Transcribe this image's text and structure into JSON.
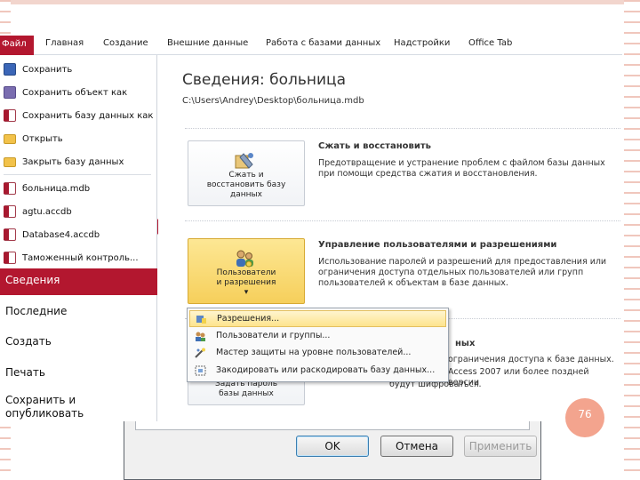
{
  "ribbon": {
    "file_tab": "Файл",
    "tabs": [
      "Главная",
      "Создание",
      "Внешние данные",
      "Работа с базами данных",
      "Надстройки",
      "Office Tab"
    ]
  },
  "left_nav": {
    "commands": [
      "Сохранить",
      "Сохранить объект как",
      "Сохранить базу данных как",
      "Открыть",
      "Закрыть базу данных"
    ],
    "recent_files": [
      "больница.mdb",
      "agtu.accdb",
      "Database4.accdb",
      "Таможенный контроль..."
    ],
    "sections": {
      "active": "Сведения",
      "recent": "Последние",
      "create": "Создать",
      "print": "Печать",
      "save_publish": "Сохранить и опубликовать"
    }
  },
  "main": {
    "title": "Сведения: больница",
    "path": "C:\\Users\\Andrey\\Desktop\\больница.mdb",
    "compact": {
      "button": "Сжать и восстановить базу данных",
      "heading": "Сжать и восстановить",
      "text": "Предотвращение и устранение проблем с файлом базы данных при помощи средства сжатия и восстановления."
    },
    "users": {
      "button": "Пользователи и разрешения ▾",
      "heading": "Управление пользователями и разрешениями",
      "text": "Использование паролей и разрешений для предоставления или ограничения доступа отдельных пользователей или групп пользователей к объектам в базе данных."
    },
    "encrypt": {
      "button": "Задать пароль базы данных",
      "heading_tail": "ных",
      "text_line1": "ограничения доступа к базе данных.",
      "text_line2": "Access 2007 или более поздней версии",
      "text_line3": "будут шифроваться."
    }
  },
  "popup_menu": {
    "items": [
      "Разрешения...",
      "Пользователи и группы...",
      "Мастер защиты на уровне пользователей...",
      "Закодировать или раскодировать базу данных..."
    ]
  },
  "dialog": {
    "ok": "OK",
    "cancel": "Отмена",
    "apply": "Применить"
  },
  "slide": {
    "page_number": "76"
  },
  "colors": {
    "accent": "#b3172f",
    "highlight": "#f6cf5b",
    "slide_badge": "#f3a48e"
  }
}
